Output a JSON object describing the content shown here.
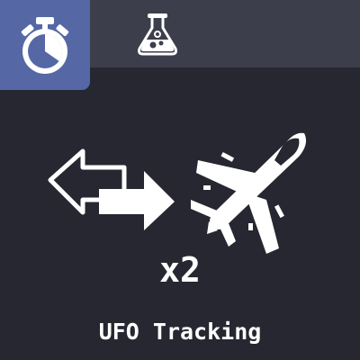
{
  "tabs": [
    {
      "icon": "stopwatch-icon",
      "active": true
    },
    {
      "icon": "flask-icon",
      "active": false
    }
  ],
  "card": {
    "multiplier": "x2",
    "title": "UFO Tracking"
  },
  "icons": {
    "swap": "swap-arrows-icon",
    "craft": "jet-plane-icon"
  },
  "colors": {
    "background": "#262731",
    "tab_bar": "#3c3e4c",
    "active_tab": "#5568a5",
    "foreground": "#ffffff"
  }
}
